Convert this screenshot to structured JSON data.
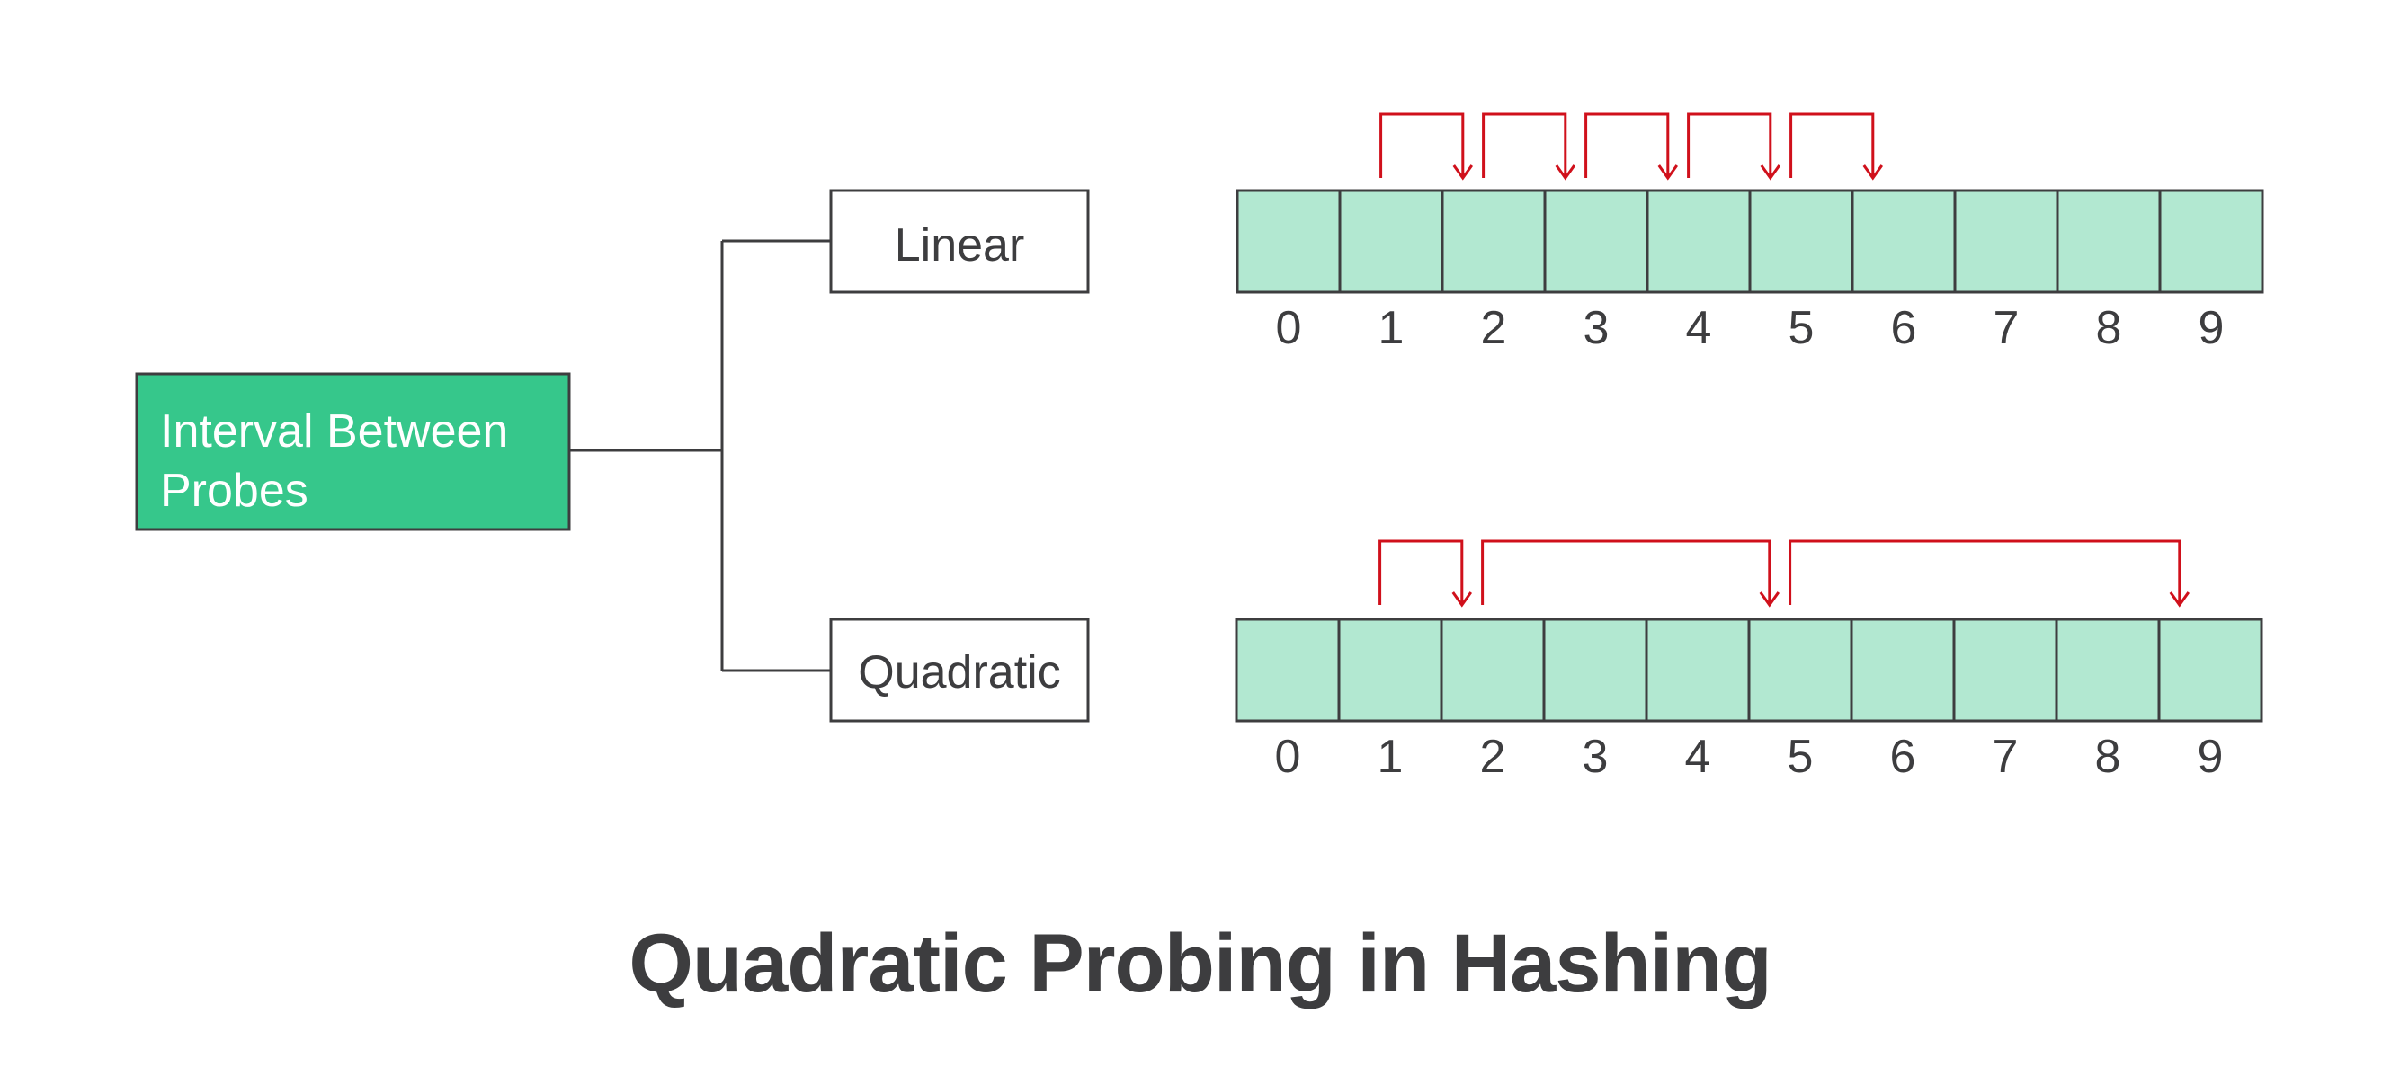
{
  "title": "Quadratic Probing in Hashing",
  "root_node": {
    "line1": "Interval Between",
    "line2": "Probes"
  },
  "branches": [
    {
      "label": "Linear",
      "indices": [
        "0",
        "1",
        "2",
        "3",
        "4",
        "5",
        "6",
        "7",
        "8",
        "9"
      ],
      "probe_jumps": [
        [
          1,
          2
        ],
        [
          2,
          3
        ],
        [
          3,
          4
        ],
        [
          4,
          5
        ],
        [
          5,
          6
        ]
      ]
    },
    {
      "label": "Quadratic",
      "indices": [
        "0",
        "1",
        "2",
        "3",
        "4",
        "5",
        "6",
        "7",
        "8",
        "9"
      ],
      "probe_jumps": [
        [
          1,
          2
        ],
        [
          2,
          5
        ],
        [
          5,
          9
        ]
      ]
    }
  ],
  "colors": {
    "root_fill": "#36c78b",
    "cell_fill": "#b2e8d1",
    "stroke": "#3d3d3f",
    "arrow": "#d0101b",
    "text": "#3d3d3f"
  }
}
